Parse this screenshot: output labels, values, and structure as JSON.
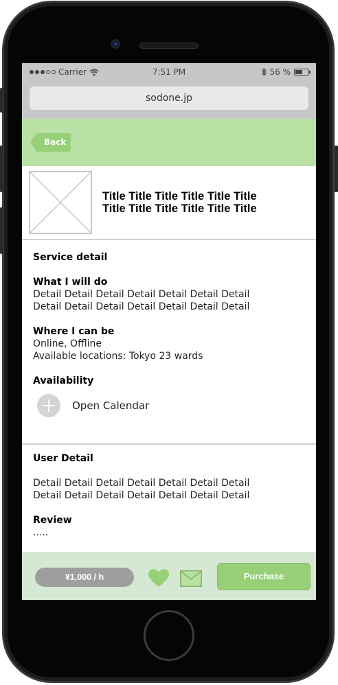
{
  "status_bar": {
    "carrier": "Carrier",
    "time": "7:51 PM",
    "battery": "56 %",
    "battery_level": 0.56,
    "signal_bars_filled": 3,
    "signal_bars_total": 5
  },
  "browser": {
    "url": "sodone.jp"
  },
  "header": {
    "back_label": "Back"
  },
  "listing": {
    "title_line1": "Title Title Title Title Title Title",
    "title_line2": "Title Title Title Title Title Title"
  },
  "service_detail": {
    "heading": "Service detail",
    "what_heading": "What I will do",
    "what_line1": "Detail Detail Detail Detail Detail Detail Detail",
    "what_line2": "Detail Detail Detail Detail Detail Detail Detail",
    "where_heading": "Where I can be",
    "where_line1": "Online, Offline",
    "where_line2": "Available locations: Tokyo 23 wards",
    "availability_heading": "Availability",
    "calendar_label": "Open Calendar"
  },
  "user_detail": {
    "heading": "User Detail",
    "line1": "Detail Detail Detail Detail Detail Detail Detail",
    "line2": "Detail Detail Detail Detail Detail Detail Detail",
    "review_heading": "Review",
    "review_text": "....."
  },
  "footer": {
    "price": "¥1,000 / h",
    "purchase_label": "Purchase"
  },
  "colors": {
    "header_bg": "#b9e0a5",
    "back_button": "#97d077",
    "footer_bg": "#d5e8d4",
    "heart": "#97d077",
    "purchase_button": "#97d077",
    "price_pill": "#9e9e9e"
  },
  "icons": [
    "wifi-icon",
    "bluetooth-icon",
    "battery-icon",
    "image-placeholder-icon",
    "plus-icon",
    "heart-icon",
    "mail-icon"
  ]
}
